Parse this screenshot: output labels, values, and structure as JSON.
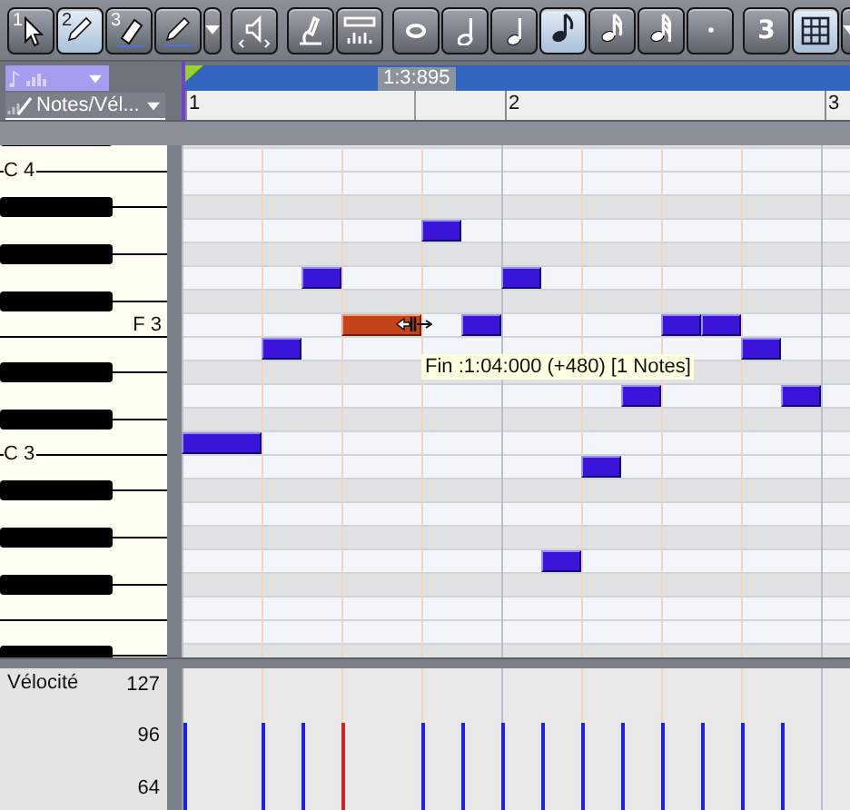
{
  "toolbar": {
    "groups": [
      [
        {
          "kind": "select",
          "number": "1",
          "selected": false
        },
        {
          "kind": "draw",
          "number": "2",
          "selected": true
        },
        {
          "kind": "erase",
          "number": "3",
          "selected": false
        },
        {
          "kind": "penline",
          "selected": false
        },
        {
          "kind": "dropdown"
        }
      ],
      [
        {
          "kind": "mute",
          "selected": false
        }
      ],
      [
        {
          "kind": "tune",
          "selected": false
        },
        {
          "kind": "meter",
          "selected": false
        }
      ],
      [
        {
          "kind": "whole",
          "selected": false
        },
        {
          "kind": "half",
          "selected": false
        },
        {
          "kind": "quarter",
          "selected": false
        },
        {
          "kind": "eighth",
          "selected": true
        },
        {
          "kind": "sixteenth",
          "selected": false
        },
        {
          "kind": "thirtysecond",
          "selected": false
        },
        {
          "kind": "dot",
          "selected": false
        }
      ],
      [
        {
          "kind": "triplet",
          "label": "3",
          "selected": false
        },
        {
          "kind": "grid",
          "selected": true
        },
        {
          "kind": "dropdown"
        }
      ]
    ]
  },
  "header": {
    "view_selector": {
      "label": "Notes/Vél..."
    },
    "position": "1:3:895",
    "bars": [
      "1",
      "2",
      "3"
    ]
  },
  "piano_roll": {
    "rows": [
      {
        "kind": "black"
      },
      {
        "kind": "c",
        "label": "C 4"
      },
      {
        "kind": "white"
      },
      {
        "kind": "black"
      },
      {
        "kind": "white",
        "steps": [
          {
            "kind": "rest"
          },
          {
            "kind": "rest"
          },
          {
            "kind": "rest"
          },
          {
            "kind": "rest"
          },
          {
            "kind": "rest"
          },
          {
            "kind": "rest"
          },
          {
            "kind": "start",
            "selected": false
          }
        ]
      },
      {
        "kind": "black"
      },
      {
        "kind": "white",
        "steps": [
          {
            "kind": "rest"
          },
          {
            "kind": "rest"
          },
          {
            "kind": "rest"
          },
          {
            "kind": "start",
            "selected": false
          },
          {
            "kind": "rest"
          },
          {
            "kind": "rest"
          },
          {
            "kind": "rest"
          },
          {
            "kind": "rest"
          },
          {
            "kind": "start",
            "selected": false
          }
        ]
      },
      {
        "kind": "black"
      },
      {
        "kind": "f",
        "label": "F 3",
        "steps": [
          {
            "kind": "rest"
          },
          {
            "kind": "rest"
          },
          {
            "kind": "rest"
          },
          {
            "kind": "rest"
          },
          {
            "kind": "start",
            "selected": true
          },
          {
            "kind": "hold",
            "selected": true
          },
          {
            "kind": "rest"
          },
          {
            "kind": "start",
            "selected": false
          },
          {
            "kind": "rest"
          },
          {
            "kind": "rest"
          },
          {
            "kind": "rest"
          },
          {
            "kind": "rest"
          },
          {
            "kind": "start",
            "selected": false
          },
          {
            "kind": "start",
            "selected": false
          }
        ]
      },
      {
        "kind": "white",
        "steps": [
          {
            "kind": "rest"
          },
          {
            "kind": "rest"
          },
          {
            "kind": "start",
            "selected": false
          },
          {
            "kind": "rest"
          },
          {
            "kind": "rest"
          },
          {
            "kind": "rest"
          },
          {
            "kind": "rest"
          },
          {
            "kind": "rest"
          },
          {
            "kind": "rest"
          },
          {
            "kind": "rest"
          },
          {
            "kind": "rest"
          },
          {
            "kind": "rest"
          },
          {
            "kind": "rest"
          },
          {
            "kind": "rest"
          },
          {
            "kind": "start",
            "selected": false
          }
        ]
      },
      {
        "kind": "black"
      },
      {
        "kind": "white",
        "steps": [
          {
            "kind": "rest"
          },
          {
            "kind": "rest"
          },
          {
            "kind": "rest"
          },
          {
            "kind": "rest"
          },
          {
            "kind": "rest"
          },
          {
            "kind": "rest"
          },
          {
            "kind": "rest"
          },
          {
            "kind": "rest"
          },
          {
            "kind": "rest"
          },
          {
            "kind": "rest"
          },
          {
            "kind": "rest"
          },
          {
            "kind": "start",
            "selected": false
          },
          {
            "kind": "rest"
          },
          {
            "kind": "rest"
          },
          {
            "kind": "rest"
          },
          {
            "kind": "start",
            "selected": false
          }
        ]
      },
      {
        "kind": "black"
      },
      {
        "kind": "c",
        "label": "C 3",
        "steps": [
          {
            "kind": "start",
            "selected": false
          },
          {
            "kind": "hold",
            "selected": false
          }
        ]
      },
      {
        "kind": "white",
        "steps": [
          {
            "kind": "rest"
          },
          {
            "kind": "rest"
          },
          {
            "kind": "rest"
          },
          {
            "kind": "rest"
          },
          {
            "kind": "rest"
          },
          {
            "kind": "rest"
          },
          {
            "kind": "rest"
          },
          {
            "kind": "rest"
          },
          {
            "kind": "rest"
          },
          {
            "kind": "rest"
          },
          {
            "kind": "start",
            "selected": false
          }
        ]
      },
      {
        "kind": "black"
      },
      {
        "kind": "white"
      },
      {
        "kind": "black"
      },
      {
        "kind": "white",
        "steps": [
          {
            "kind": "rest"
          },
          {
            "kind": "rest"
          },
          {
            "kind": "rest"
          },
          {
            "kind": "rest"
          },
          {
            "kind": "rest"
          },
          {
            "kind": "rest"
          },
          {
            "kind": "rest"
          },
          {
            "kind": "rest"
          },
          {
            "kind": "rest"
          },
          {
            "kind": "start",
            "selected": false
          }
        ]
      },
      {
        "kind": "black"
      },
      {
        "kind": "f"
      },
      {
        "kind": "white"
      },
      {
        "kind": "black"
      }
    ],
    "tooltip": "Fin :1:04:000 (+480) [1 Notes]"
  },
  "velocity_lane": {
    "title": "Vélocité",
    "scale": [
      "127",
      "96",
      "64"
    ]
  }
}
